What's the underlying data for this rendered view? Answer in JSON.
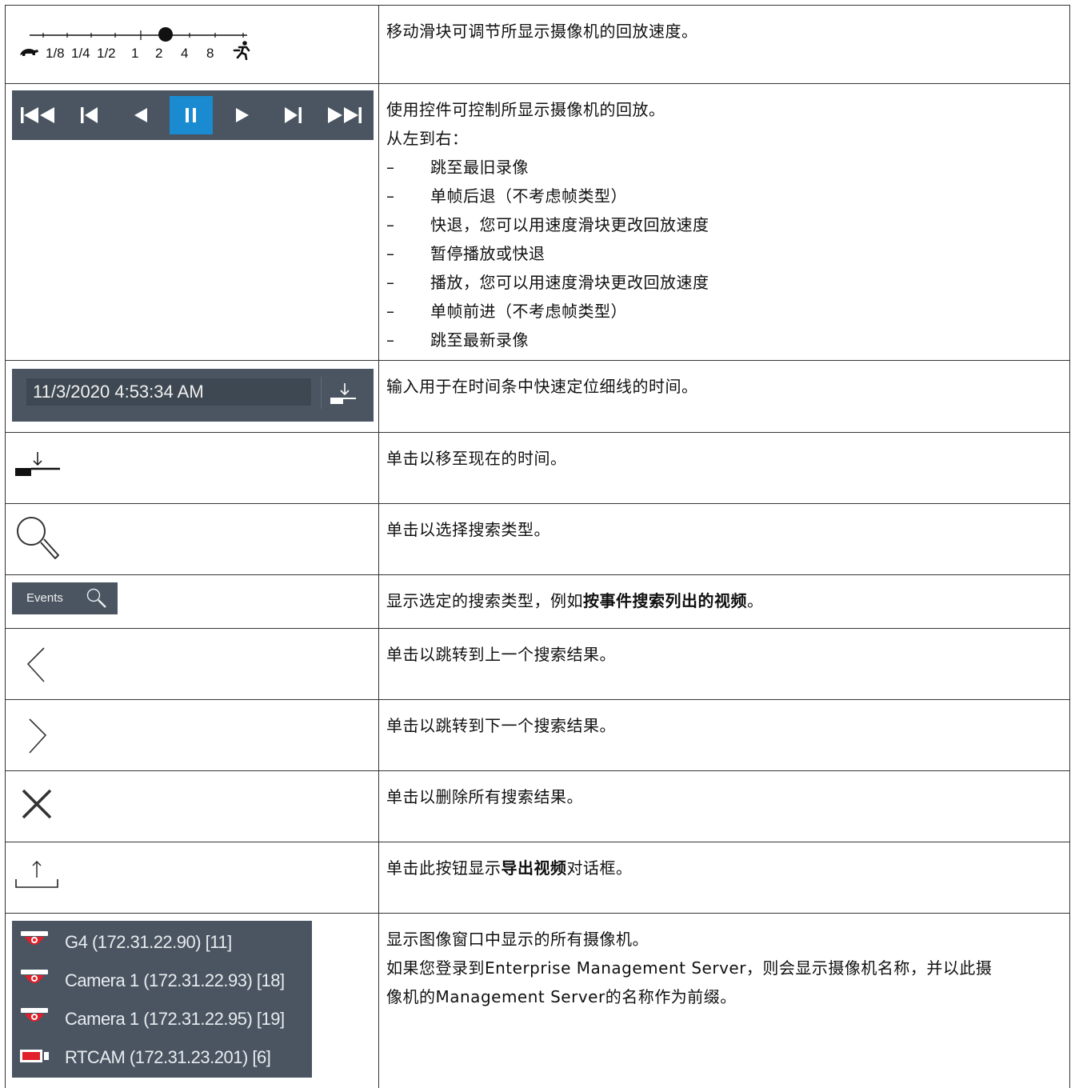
{
  "speed_slider": {
    "labels": [
      "1/8",
      "1/4",
      "1/2",
      "1",
      "2",
      "4",
      "8"
    ],
    "selected": "2",
    "slow_icon": "turtle-icon",
    "fast_icon": "runner-icon",
    "description": "移动滑块可调节所显示摄像机的回放速度。"
  },
  "playback": {
    "buttons": [
      {
        "name": "jump-oldest-button",
        "icon": "skip-to-start-icon"
      },
      {
        "name": "step-back-button",
        "icon": "step-back-icon"
      },
      {
        "name": "rewind-button",
        "icon": "play-reverse-icon"
      },
      {
        "name": "pause-button",
        "icon": "pause-icon",
        "active": true
      },
      {
        "name": "play-button",
        "icon": "play-icon"
      },
      {
        "name": "step-forward-button",
        "icon": "step-forward-icon"
      },
      {
        "name": "jump-newest-button",
        "icon": "skip-to-end-icon"
      }
    ],
    "active_color": "#1a8bd0",
    "intro": "使用控件可控制所显示摄像机的回放。",
    "order": "从左到右：",
    "items": [
      "跳至最旧录像",
      "单帧后退（不考虑帧类型）",
      "快退，您可以用速度滑块更改回放速度",
      "暂停播放或快退",
      "播放，您可以用速度滑块更改回放速度",
      "单帧前进（不考虑帧类型）",
      "跳至最新录像"
    ],
    "dash": "–"
  },
  "time_input": {
    "value": "11/3/2020 4:53:34 AM",
    "description": "输入用于在时间条中快速定位细线的时间。"
  },
  "goto_now": {
    "description": "单击以移至现在的时间。"
  },
  "search": {
    "description": "单击以选择搜索类型。"
  },
  "events_button": {
    "label": "Events",
    "desc_prefix": "显示选定的搜索类型，例如",
    "desc_bold": "按事件搜索列出的视频",
    "desc_suffix": "。"
  },
  "prev_result": {
    "description": "单击以跳转到上一个搜索结果。"
  },
  "next_result": {
    "description": "单击以跳转到下一个搜索结果。"
  },
  "clear_results": {
    "description": "单击以删除所有搜索结果。"
  },
  "export": {
    "desc_prefix": "单击此按钮显示",
    "desc_bold": "导出视频",
    "desc_suffix": "对话框。"
  },
  "cameras": {
    "list": [
      {
        "name": "G4 (172.31.22.90) [11]",
        "icon": "dome-camera-icon"
      },
      {
        "name": "Camera 1 (172.31.22.93) [18]",
        "icon": "dome-camera-icon"
      },
      {
        "name": "Camera 1 (172.31.22.95) [19]",
        "icon": "dome-camera-icon"
      },
      {
        "name": "RTCAM (172.31.23.201) [6]",
        "icon": "box-camera-icon"
      }
    ],
    "line1": "显示图像窗口中显示的所有摄像机。",
    "line2": "如果您登录到Enterprise Management Server，则会显示摄像机名称，并以此摄",
    "line3": "像机的Management Server的名称作为前缀。"
  },
  "colors": {
    "panel": "#4a5561",
    "accent": "#1a8bd0",
    "camera_red": "#e0202a"
  }
}
